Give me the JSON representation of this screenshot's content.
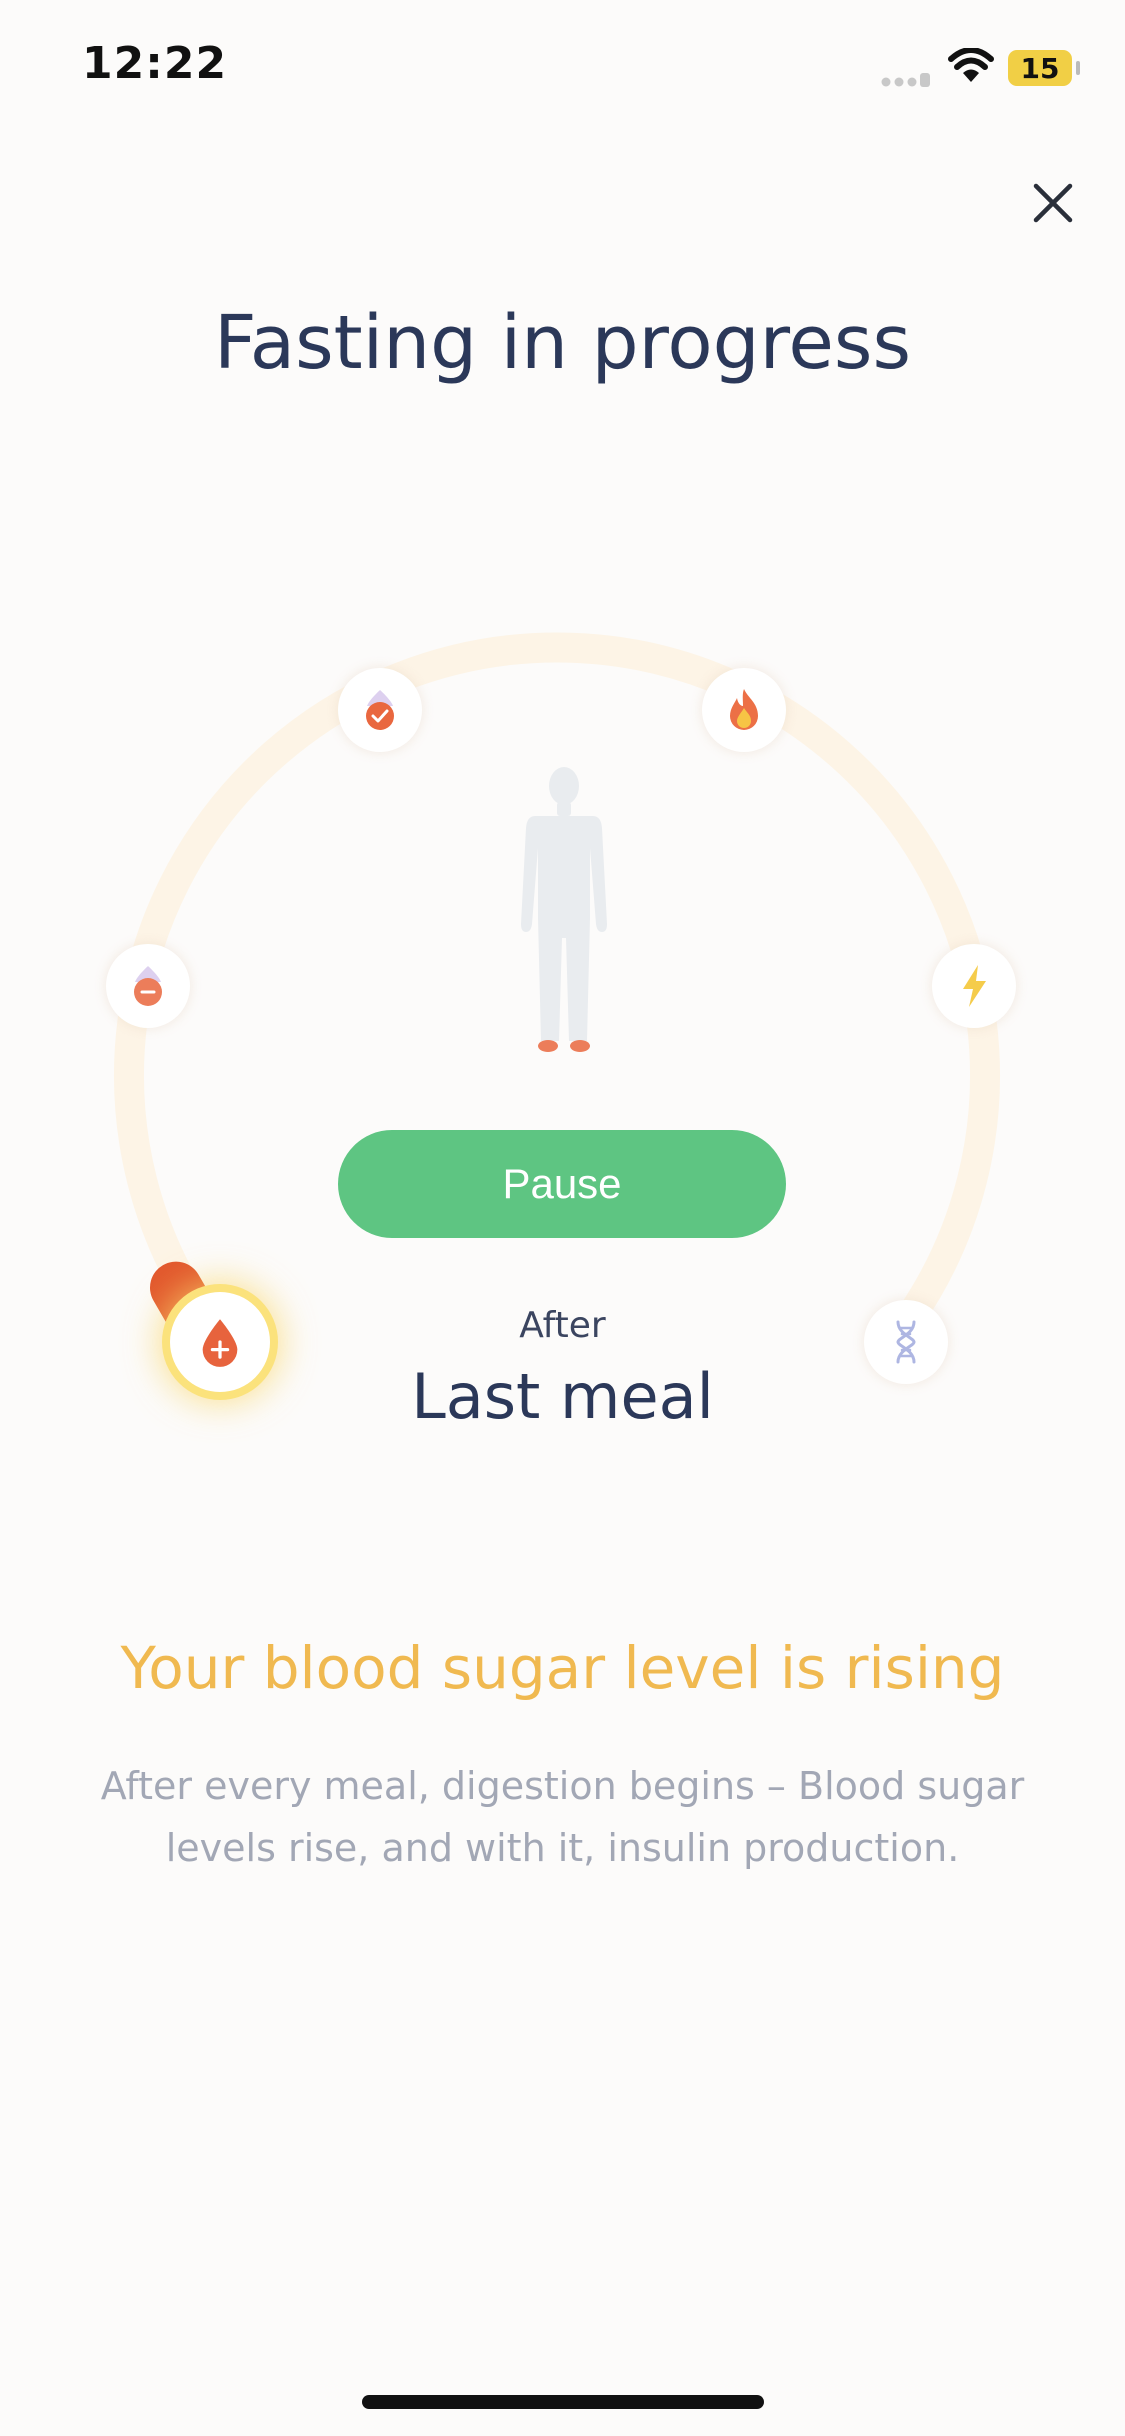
{
  "status_bar": {
    "time": "12:22",
    "battery": "15"
  },
  "header": {
    "title": "Fasting in progress"
  },
  "stages": [
    {
      "name": "blood-sugar-rising",
      "icon": "blood-drop-plus-icon",
      "active": true
    },
    {
      "name": "blood-sugar-falling",
      "icon": "blood-drop-minus-icon",
      "active": false
    },
    {
      "name": "blood-sugar-normal",
      "icon": "blood-drop-check-icon",
      "active": false
    },
    {
      "name": "fat-burning",
      "icon": "flame-icon",
      "active": false
    },
    {
      "name": "ketosis",
      "icon": "lightning-icon",
      "active": false
    },
    {
      "name": "autophagy",
      "icon": "dna-icon",
      "active": false
    }
  ],
  "controls": {
    "pause_label": "Pause"
  },
  "timer": {
    "prefix": "After",
    "label": "Last meal"
  },
  "info": {
    "headline": "Your blood sugar level is rising",
    "description": "After every meal, digestion begins – Blood sugar levels rise, and with it, insulin production."
  },
  "colors": {
    "title": "#2b3859",
    "accent_green": "#5ec582",
    "headline": "#f0b950",
    "arc": "#fdf4e6",
    "indicator": "#e2582d",
    "glow": "#fbe27c"
  }
}
